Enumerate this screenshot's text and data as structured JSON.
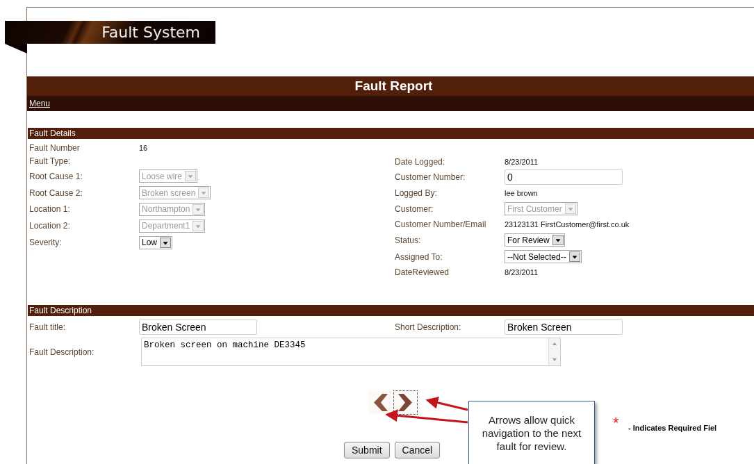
{
  "logo": {
    "title": "Fault System"
  },
  "page_title": "Fault Report",
  "menu_link": "Menu",
  "fault_details": {
    "header": "Fault Details",
    "left": [
      {
        "label": "Fault Number",
        "kind": "text",
        "value": "16"
      },
      {
        "label": "Fault Type:",
        "kind": "label"
      },
      {
        "label": "Root Cause 1:",
        "kind": "select",
        "value": "Loose wire",
        "disabled": true
      },
      {
        "label": "Root Cause 2:",
        "kind": "select",
        "value": "Broken screen",
        "disabled": true
      },
      {
        "label": "Location 1:",
        "kind": "select",
        "value": "Northampton",
        "disabled": true
      },
      {
        "label": "Location 2:",
        "kind": "select",
        "value": "Department1",
        "disabled": true
      },
      {
        "label": "Severity:",
        "kind": "select",
        "value": "Low",
        "disabled": false
      }
    ],
    "right": [
      {
        "label": "Date Logged:",
        "kind": "text",
        "value": "8/23/2011"
      },
      {
        "label": "Customer Number:",
        "kind": "input",
        "value": "0"
      },
      {
        "label": "Logged By:",
        "kind": "text",
        "value": "lee brown"
      },
      {
        "label": "Customer:",
        "kind": "select",
        "value": "First Customer",
        "disabled": true
      },
      {
        "label": "Customer Number/Email",
        "kind": "text",
        "value": "23123131 FirstCustomer@first.co.uk"
      },
      {
        "label": "Status:",
        "kind": "select",
        "value": "For Review",
        "disabled": false
      },
      {
        "label": "Assigned To:",
        "kind": "select",
        "value": "--Not Selected--",
        "disabled": false
      },
      {
        "label": "DateReviewed",
        "kind": "text",
        "value": "8/23/2011"
      }
    ]
  },
  "fault_description": {
    "header": "Fault Description",
    "fault_title": {
      "label": "Fault title:",
      "value": "Broken Screen"
    },
    "short_description": {
      "label": "Short Description:",
      "value": "Broken Screen"
    },
    "description": {
      "label": "Fault Description:",
      "value": "Broken screen on machine DE3345"
    }
  },
  "buttons": [
    "Submit",
    "Cancel"
  ],
  "callout": "Arrows allow quick navigation to the next fault for review.",
  "required_note": {
    "mark": "*",
    "text": "- Indicates Required Fiel"
  }
}
